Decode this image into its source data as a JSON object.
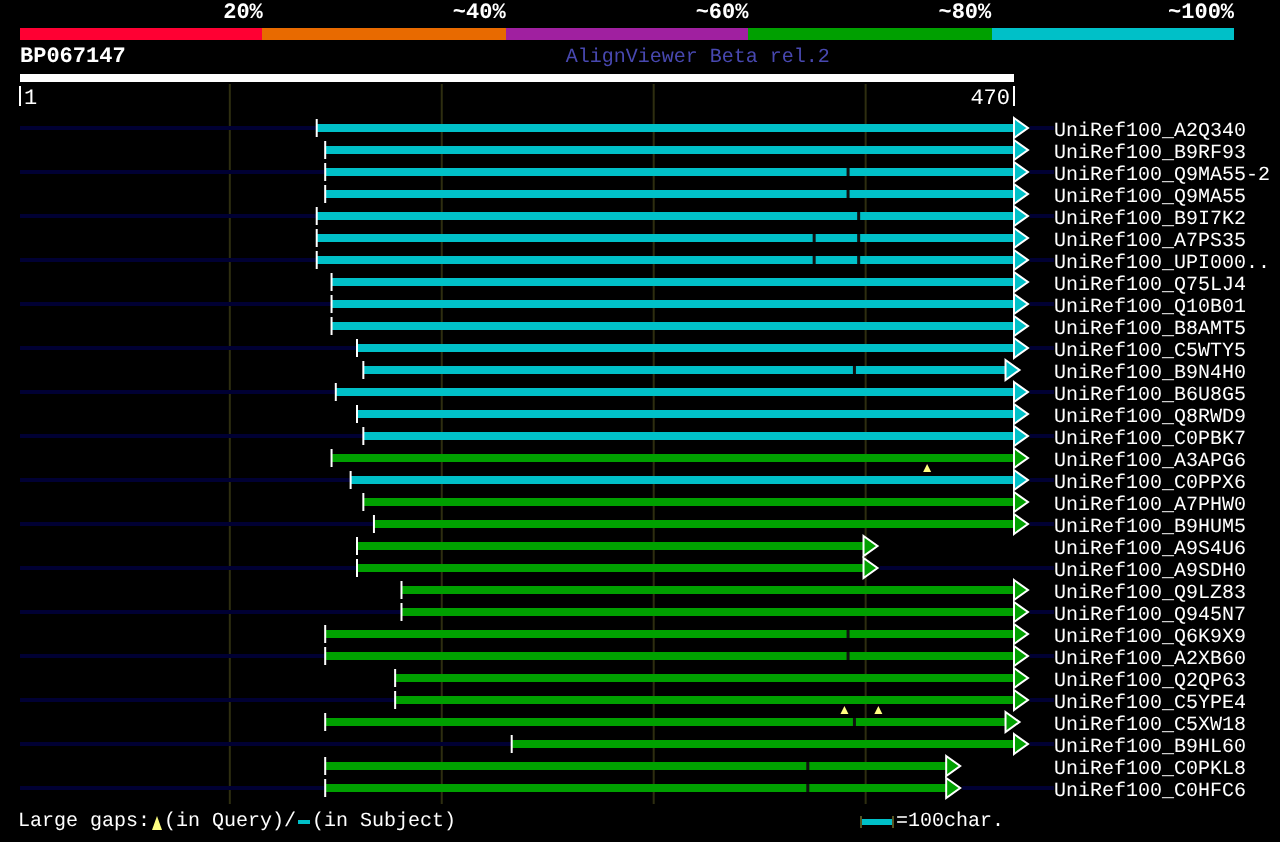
{
  "identity_legend": [
    {
      "label": "20%",
      "color": "#ff0033"
    },
    {
      "label": "~40%",
      "color": "#e86a00"
    },
    {
      "label": "~60%",
      "color": "#a020a0"
    },
    {
      "label": "~80%",
      "color": "#00a000"
    },
    {
      "label": "~100%",
      "color": "#00c0c8"
    }
  ],
  "query": {
    "title": "BP067147",
    "credit": "AlignViewer Beta rel.2",
    "ruler_start": "1",
    "ruler_end": "470"
  },
  "hits": [
    {
      "name": "UniRef100_A2Q340",
      "color": "#00c0c8",
      "overhang": true
    },
    {
      "name": "UniRef100_B9RF93",
      "color": "#00c0c8",
      "overhang": false
    },
    {
      "name": "UniRef100_Q9MA55-2",
      "color": "#00c0c8",
      "overhang": true
    },
    {
      "name": "UniRef100_Q9MA55",
      "color": "#00c0c8",
      "overhang": false
    },
    {
      "name": "UniRef100_B9I7K2",
      "color": "#00c0c8",
      "overhang": true
    },
    {
      "name": "UniRef100_A7PS35",
      "color": "#00c0c8",
      "overhang": false
    },
    {
      "name": "UniRef100_UPI000..",
      "color": "#00c0c8",
      "overhang": true
    },
    {
      "name": "UniRef100_Q75LJ4",
      "color": "#00c0c8",
      "overhang": false
    },
    {
      "name": "UniRef100_Q10B01",
      "color": "#00c0c8",
      "overhang": true
    },
    {
      "name": "UniRef100_B8AMT5",
      "color": "#00c0c8",
      "overhang": false
    },
    {
      "name": "UniRef100_C5WTY5",
      "color": "#00c0c8",
      "overhang": true
    },
    {
      "name": "UniRef100_B9N4H0",
      "color": "#00c0c8",
      "overhang": false
    },
    {
      "name": "UniRef100_B6U8G5",
      "color": "#00c0c8",
      "overhang": true
    },
    {
      "name": "UniRef100_Q8RWD9",
      "color": "#00c0c8",
      "overhang": false
    },
    {
      "name": "UniRef100_C0PBK7",
      "color": "#00c0c8",
      "overhang": true
    },
    {
      "name": "UniRef100_A3APG6",
      "color": "#00a000",
      "overhang": false
    },
    {
      "name": "UniRef100_C0PPX6",
      "color": "#00c0c8",
      "overhang": true
    },
    {
      "name": "UniRef100_A7PHW0",
      "color": "#00a000",
      "overhang": false
    },
    {
      "name": "UniRef100_B9HUM5",
      "color": "#00a000",
      "overhang": true
    },
    {
      "name": "UniRef100_A9S4U6",
      "color": "#00a000",
      "overhang": false
    },
    {
      "name": "UniRef100_A9SDH0",
      "color": "#00a000",
      "overhang": true
    },
    {
      "name": "UniRef100_Q9LZ83",
      "color": "#00a000",
      "overhang": false
    },
    {
      "name": "UniRef100_Q945N7",
      "color": "#00a000",
      "overhang": true
    },
    {
      "name": "UniRef100_Q6K9X9",
      "color": "#00a000",
      "overhang": false
    },
    {
      "name": "UniRef100_A2XB60",
      "color": "#00a000",
      "overhang": true
    },
    {
      "name": "UniRef100_Q2QP63",
      "color": "#00a000",
      "overhang": false
    },
    {
      "name": "UniRef100_C5YPE4",
      "color": "#00a000",
      "overhang": true
    },
    {
      "name": "UniRef100_C5XW18",
      "color": "#00a000",
      "overhang": false
    },
    {
      "name": "UniRef100_B9HL60",
      "color": "#00a000",
      "overhang": true
    },
    {
      "name": "UniRef100_C0PKL8",
      "color": "#00a000",
      "overhang": false
    },
    {
      "name": "UniRef100_C0HFC6",
      "color": "#00a000",
      "overhang": true
    }
  ],
  "footer": {
    "gaps_label": "Large gaps:",
    "query_gap_label": "(in Query)/",
    "subject_gap_label": "(in Subject)",
    "scale_label": "=100char."
  }
}
